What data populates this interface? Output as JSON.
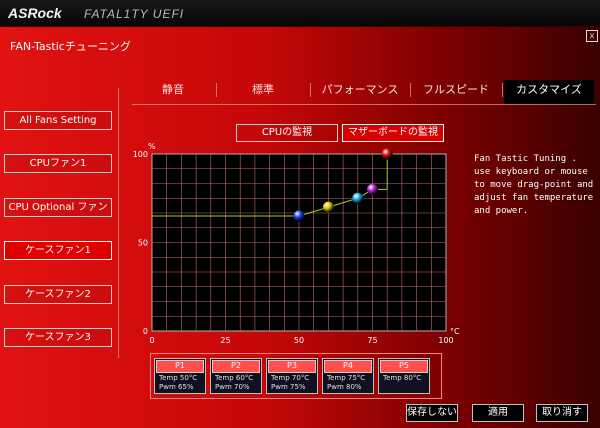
{
  "header": {
    "brand": "ASRock",
    "sub": "FATAL1TY UEFI"
  },
  "window": {
    "title": "FAN-Tasticチューニング",
    "close_label": "x"
  },
  "tabs": [
    {
      "label": "静音"
    },
    {
      "label": "標準"
    },
    {
      "label": "パフォーマンス"
    },
    {
      "label": "フルスピード"
    },
    {
      "label": "カスタマイズ",
      "active": true
    }
  ],
  "sidebar": [
    {
      "label": "All Fans Setting"
    },
    {
      "label": "CPUファン1"
    },
    {
      "label": "CPU Optional ファン"
    },
    {
      "label": "ケースファン1",
      "active": true
    },
    {
      "label": "ケースファン2"
    },
    {
      "label": "ケースファン3"
    }
  ],
  "monitor": {
    "cpu": "CPUの監視",
    "mb": "マザーボードの監視"
  },
  "help": "Fan Tastic Tuning . use keyboard or mouse to move drag-point and adjust fan temperature and power.",
  "chart_data": {
    "type": "line",
    "x_unit": "°C",
    "y_unit": "%",
    "xlim": [
      0,
      100
    ],
    "ylim": [
      0,
      100
    ],
    "x_ticks": [
      "0",
      "25",
      "50",
      "75",
      "100"
    ],
    "y_ticks": [
      "0",
      "50",
      "100"
    ],
    "grid": true,
    "x": [
      0,
      50,
      60,
      70,
      75,
      80,
      80
    ],
    "y": [
      65,
      65,
      70,
      75,
      80,
      80,
      100
    ],
    "points": [
      {
        "name": "P1",
        "x": 50,
        "y": 65,
        "color": "#2040ff"
      },
      {
        "name": "P2",
        "x": 60,
        "y": 70,
        "color": "#e0c000"
      },
      {
        "name": "P3",
        "x": 70,
        "y": 75,
        "color": "#20b0e0"
      },
      {
        "name": "P4",
        "x": 75,
        "y": 80,
        "color": "#c020e0"
      },
      {
        "name": "P5",
        "x": 80,
        "y": 100,
        "color": "#e01010"
      }
    ]
  },
  "pcards": [
    {
      "name": "P1",
      "temp": "Temp 50°C",
      "pwm": "Pwm  65%"
    },
    {
      "name": "P2",
      "temp": "Temp 60°C",
      "pwm": "Pwm  70%"
    },
    {
      "name": "P3",
      "temp": "Temp 70°C",
      "pwm": "Pwm  75%"
    },
    {
      "name": "P4",
      "temp": "Temp 75°C",
      "pwm": "Pwm  80%"
    },
    {
      "name": "P5",
      "temp": "Temp 80°C",
      "pwm": ""
    }
  ],
  "actions": {
    "discard": "保存しない",
    "apply": "適用",
    "cancel": "取り消す"
  }
}
